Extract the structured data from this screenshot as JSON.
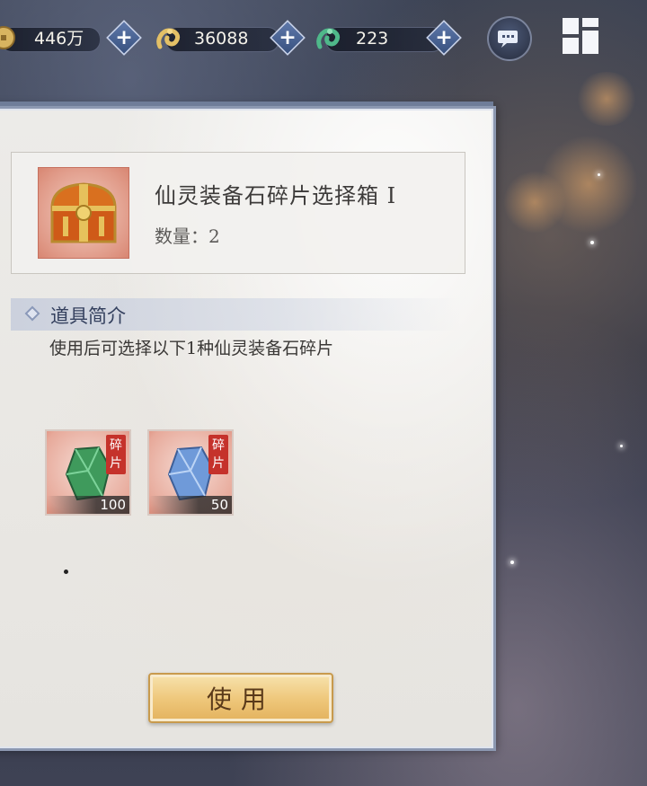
{
  "resources": [
    {
      "icon": "coin-icon",
      "value": "446万"
    },
    {
      "icon": "gold-dragon-icon",
      "value": "36088"
    },
    {
      "icon": "jade-dragon-icon",
      "value": "223"
    }
  ],
  "top_icons": {
    "chat": "chat-icon",
    "menu": "grid-menu-icon"
  },
  "item": {
    "name": "仙灵装备石碎片选择箱 I",
    "quantity_label": "数量：2",
    "icon": "treasure-chest-icon"
  },
  "intro": {
    "title": "道具简介",
    "description": "使用后可选择以下1种仙灵装备石碎片"
  },
  "rewards": [
    {
      "tag_line1": "碎",
      "tag_line2": "片",
      "count": "100",
      "gem_color": "#4aa86a",
      "icon": "green-gem-shard-icon"
    },
    {
      "tag_line1": "碎",
      "tag_line2": "片",
      "count": "50",
      "gem_color": "#6f9ad9",
      "icon": "blue-gem-shard-icon"
    }
  ],
  "actions": {
    "use_label": "使用"
  },
  "colors": {
    "button_gold": "#eec679",
    "tag_red": "#c5322b",
    "panel_border": "#8c98b1"
  }
}
